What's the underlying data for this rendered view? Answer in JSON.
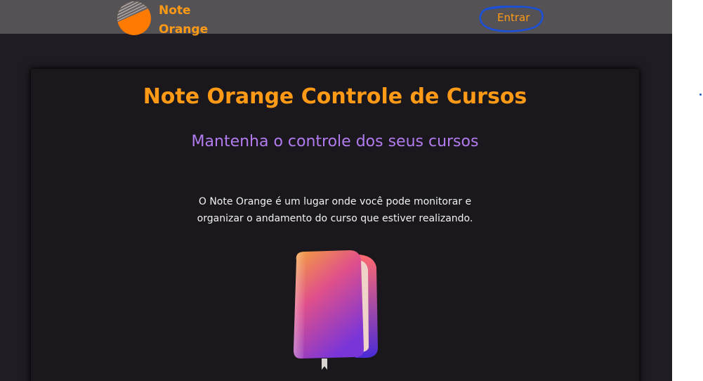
{
  "header": {
    "logo_line1": "Note",
    "logo_line2": "Orange",
    "login_label": "Entrar"
  },
  "hero": {
    "title": "Note Orange Controle de Cursos",
    "subtitle": "Mantenha o controle dos seus cursos",
    "description_line1": "O Note Orange é um lugar onde você pode monitorar e",
    "description_line2": "organizar o andamento do curso que estiver realizando."
  },
  "icons": {
    "logo": "note-orange-logo-icon",
    "illustration": "book-icon"
  },
  "colors": {
    "accent": "#ff9a16",
    "subtitle": "#b27bf0",
    "header_bg": "#555256",
    "page_bg": "#1f1c23",
    "annotation": "#1a4fd6"
  }
}
